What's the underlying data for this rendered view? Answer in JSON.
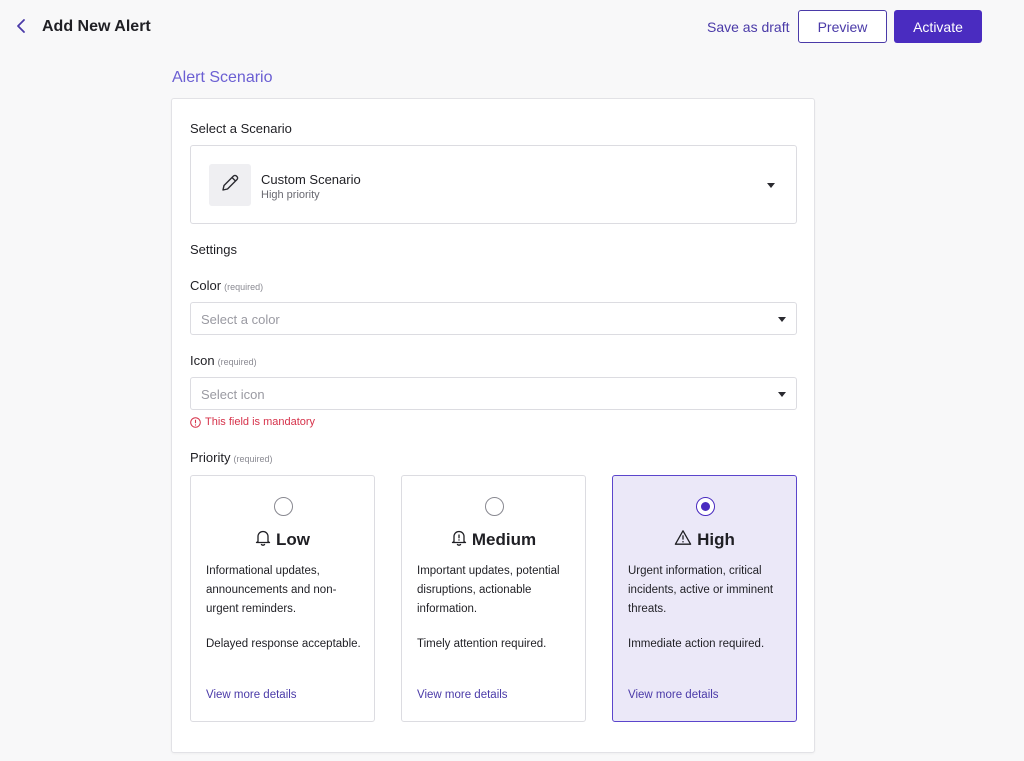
{
  "header": {
    "title": "Add New Alert",
    "save_draft": "Save as draft",
    "preview": "Preview",
    "activate": "Activate"
  },
  "section": {
    "title": "Alert Scenario"
  },
  "scenario": {
    "label": "Select a Scenario",
    "name": "Custom Scenario",
    "sub": "High priority"
  },
  "settings": {
    "label": "Settings",
    "required": "(required)",
    "color": {
      "label": "Color",
      "placeholder": "Select a color"
    },
    "icon": {
      "label": "Icon",
      "placeholder": "Select icon",
      "error": "This field is mandatory"
    },
    "priority": {
      "label": "Priority",
      "selected": "High",
      "options": [
        {
          "title": "Low",
          "icon": "bell-icon",
          "desc": "Informational updates, announcements and non-urgent reminders.",
          "note": "Delayed response acceptable.",
          "link": "View more details"
        },
        {
          "title": "Medium",
          "icon": "bell-alert-icon",
          "desc": "Important updates, potential disruptions, actionable information.",
          "note": "Timely attention required.",
          "link": "View more details"
        },
        {
          "title": "High",
          "icon": "warning-triangle-icon",
          "desc": "Urgent information, critical incidents, active or imminent threats.",
          "note": "Immediate action required.",
          "link": "View more details"
        }
      ]
    }
  },
  "colors": {
    "accent": "#4a2cc0",
    "link": "#4a3aa8",
    "section_title": "#6b5fd3",
    "error": "#d6324a",
    "selected_bg": "#ebe8f8"
  }
}
